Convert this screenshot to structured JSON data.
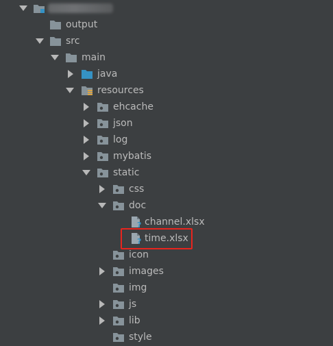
{
  "icons": {
    "folder": "folder-icon",
    "source_folder": "source-folder-icon",
    "resources_folder": "resources-folder-icon",
    "package_folder": "package-folder-icon",
    "unknown_file": "unknown-file-icon",
    "module": "module-icon"
  },
  "colors": {
    "background": "#3c3f41",
    "text": "#bbbbbb",
    "folder": "#87939a",
    "source_folder": "#3592c4",
    "highlight_border": "#e8251e"
  },
  "tree": [
    {
      "label": "",
      "icon": "module",
      "expanded": true,
      "redacted": true
    },
    {
      "label": "output",
      "icon": "folder"
    },
    {
      "label": "src",
      "icon": "folder",
      "expanded": true
    },
    {
      "label": "main",
      "icon": "folder",
      "expanded": true
    },
    {
      "label": "java",
      "icon": "source_folder",
      "expanded": false
    },
    {
      "label": "resources",
      "icon": "resources_folder",
      "expanded": true
    },
    {
      "label": "ehcache",
      "icon": "package_folder",
      "expanded": false
    },
    {
      "label": "json",
      "icon": "package_folder",
      "expanded": false
    },
    {
      "label": "log",
      "icon": "package_folder",
      "expanded": false
    },
    {
      "label": "mybatis",
      "icon": "package_folder",
      "expanded": false
    },
    {
      "label": "static",
      "icon": "package_folder",
      "expanded": true
    },
    {
      "label": "css",
      "icon": "package_folder",
      "expanded": false
    },
    {
      "label": "doc",
      "icon": "package_folder",
      "expanded": true
    },
    {
      "label": "channel.xlsx",
      "icon": "unknown_file"
    },
    {
      "label": "time.xlsx",
      "icon": "unknown_file",
      "highlighted": true
    },
    {
      "label": "icon",
      "icon": "package_folder"
    },
    {
      "label": "images",
      "icon": "package_folder",
      "expanded": false
    },
    {
      "label": "img",
      "icon": "package_folder"
    },
    {
      "label": "js",
      "icon": "package_folder",
      "expanded": false
    },
    {
      "label": "lib",
      "icon": "package_folder",
      "expanded": false
    },
    {
      "label": "style",
      "icon": "package_folder"
    }
  ]
}
